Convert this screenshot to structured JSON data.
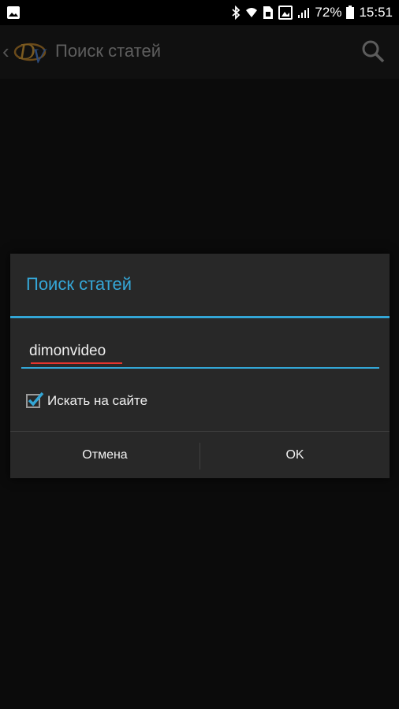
{
  "status_bar": {
    "battery_percent": "72%",
    "time": "15:51"
  },
  "action_bar": {
    "title": "Поиск статей"
  },
  "dialog": {
    "title": "Поиск статей",
    "input_value": "dimonvideo",
    "checkbox_label": "Искать на сайте",
    "checkbox_checked": true,
    "cancel_label": "Отмена",
    "ok_label": "OK"
  },
  "colors": {
    "accent": "#33a6d6",
    "spell_error": "#e5342d"
  }
}
